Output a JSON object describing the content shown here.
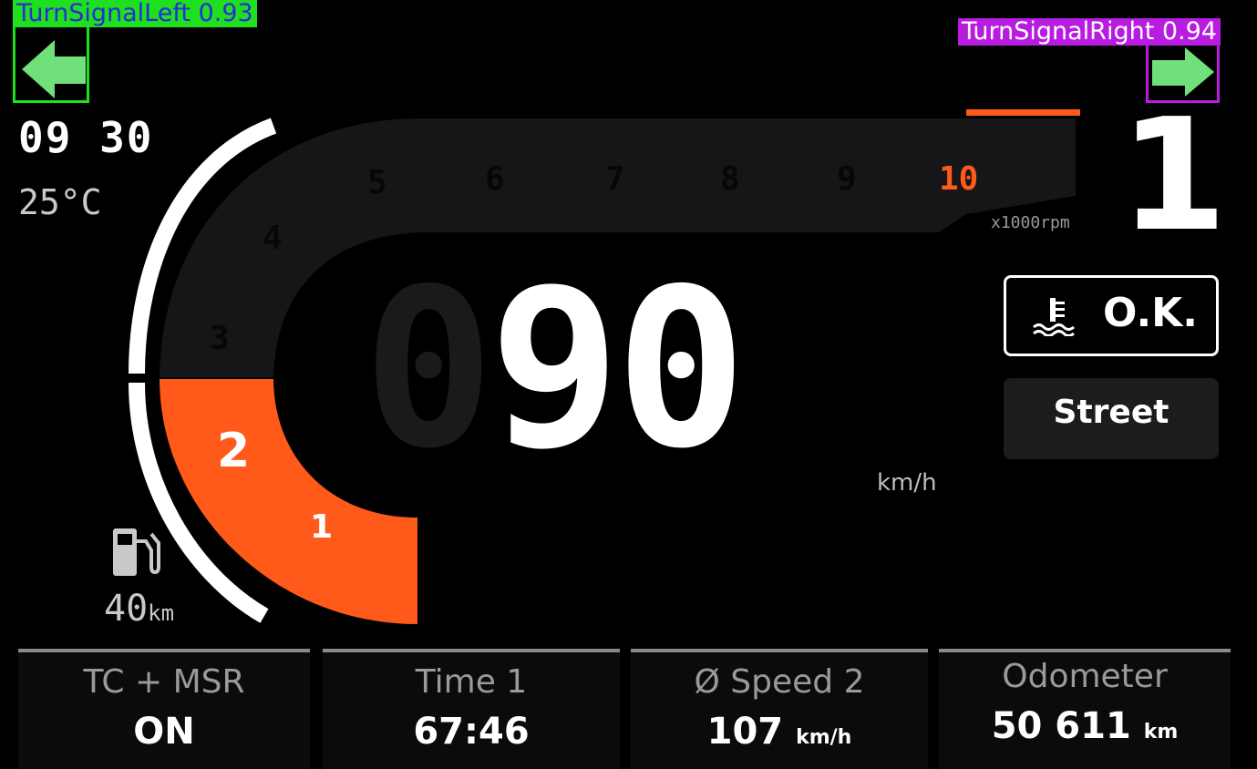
{
  "detections": {
    "left_label": "TurnSignalLeft  0.93",
    "right_label": "TurnSignalRight  0.94"
  },
  "status": {
    "clock": "09 30",
    "temperature": "25°C",
    "gear": "1",
    "coolant": "O.K.",
    "mode": "Street",
    "fuel_range_value": "40",
    "fuel_range_unit": "km"
  },
  "tachometer": {
    "ticks": [
      "1",
      "2",
      "3",
      "4",
      "5",
      "6",
      "7",
      "8",
      "9",
      "10"
    ],
    "unit": "x1000rpm",
    "redline_color": "#ff5a1a"
  },
  "speed": {
    "ghost_digit": "0",
    "value": "90",
    "unit": "km/h"
  },
  "info_cells": [
    {
      "title": "TC + MSR",
      "value": "ON",
      "unit": ""
    },
    {
      "title": "Time 1",
      "value": "67:46",
      "unit": ""
    },
    {
      "title": "Ø Speed 2",
      "value": "107",
      "unit": "km/h"
    },
    {
      "title": "Odometer",
      "value": "50 611",
      "unit": "km"
    }
  ],
  "icons": [
    "turn-signal-left-icon",
    "turn-signal-right-icon",
    "coolant-temperature-icon",
    "fuel-pump-icon"
  ],
  "colors": {
    "accent": "#ff5a1a",
    "turn_signal": "#6fe07a",
    "detection_left": "#1fe01f",
    "detection_right": "#b71ce0"
  }
}
